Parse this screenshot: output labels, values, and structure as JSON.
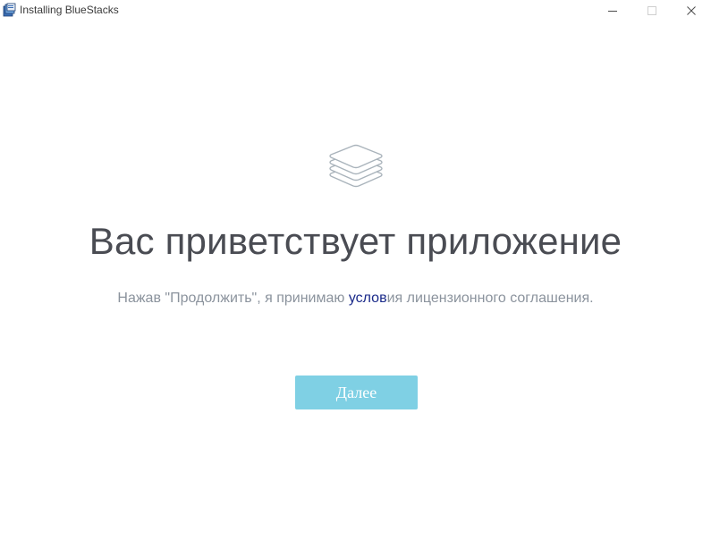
{
  "window": {
    "title": "Installing BlueStacks",
    "controls": {
      "minimize_icon": "minimize-icon",
      "maximize_icon": "maximize-icon",
      "close_icon": "close-icon"
    }
  },
  "main": {
    "logo_icon": "stack-layers-icon",
    "title": "Вас приветствует приложение",
    "license": {
      "prefix": "Нажав \"Продолжить\", я принимаю ",
      "link_text": "услов",
      "suffix": "ия лицензионного соглашения."
    },
    "next_button_label": "Далее"
  },
  "colors": {
    "title_text": "#4a4c53",
    "muted_text": "#8b939d",
    "link": "#1a2a8a",
    "button_bg": "#7fd0e4",
    "button_text": "#ffffff"
  }
}
